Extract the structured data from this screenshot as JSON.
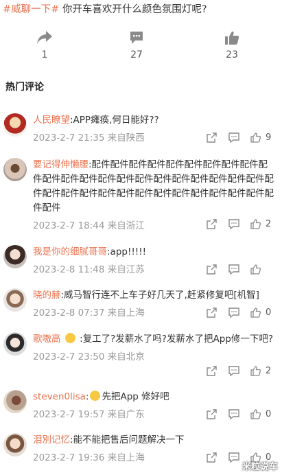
{
  "post": {
    "topic": "#威聊一下#",
    "title": "你开车喜欢开什么颜色氛围灯呢?"
  },
  "actions": {
    "share": {
      "icon": "share-arrow-icon",
      "count": "1"
    },
    "comment": {
      "icon": "comment-bubble-icon",
      "count": "27"
    },
    "like": {
      "icon": "thumbs-up-icon",
      "count": "23"
    }
  },
  "hot_comments_title": "热门评论",
  "comments": [
    {
      "user": "人民瞭望",
      "text": ":APP瘫痪,何日能好??",
      "date": "2023-2-7 21:35",
      "location": "来自陕西",
      "likes": "9"
    },
    {
      "user": "要记得伸懒腰",
      "text": ":配件配件配件配件配件配件配件配件配件配件配件配件配件配件配件配件配件配件配件配件配件配件配件配件配件配件配件配件配件配件配件配件配件配件配件配件配件",
      "date": "2023-2-7 18:44",
      "location": "来自浙江",
      "likes": "2"
    },
    {
      "user": "我是你的细腻哥哥",
      "text": ":app!!!!!",
      "date": "2023-2-8 11:48",
      "location": "来自江苏",
      "likes": ""
    },
    {
      "user": "晓的赫",
      "text": ":威马智行连不上车子好几天了,赶紧修复吧[机智]",
      "date": "2023-2-8 07:37",
      "location": "来自上海",
      "likes": "0"
    },
    {
      "user": "歌嗷高",
      "text": ":复工了?发薪水了吗?发薪水了把App修一下吧?",
      "date": "2023-2-7 23:50",
      "location": "来自北京",
      "likes": "2"
    },
    {
      "user": "steven0lisa",
      "text": "先把App 修好吧",
      "date": "2023-2-7 19:57",
      "location": "来自广东",
      "likes": "0"
    },
    {
      "user": "泪別记忆",
      "text": ":能不能把售后问题解决一下",
      "date": "2023-2-7 19:36",
      "location": "来自上海",
      "likes": "0"
    }
  ],
  "watermark": "米粒说车",
  "colors": {
    "accent": "#eb7350",
    "meta": "#999999",
    "icon": "#888888"
  }
}
